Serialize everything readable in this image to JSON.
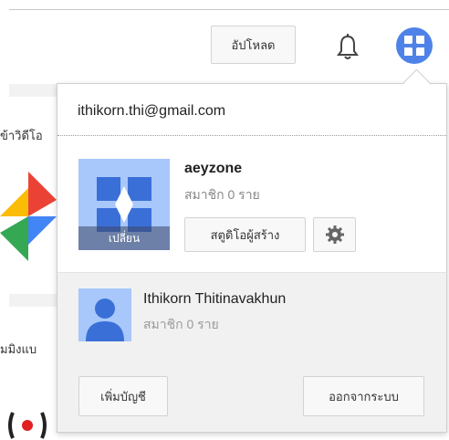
{
  "header": {
    "upload_label": "อัปโหลด",
    "bell_icon": "notifications-bell-icon",
    "avatar_icon": "channel-avatar-icon"
  },
  "background": {
    "snippet1": "ข้าวิดีโอ",
    "snippet2": "มมิงแบ"
  },
  "popup": {
    "email": "ithikorn.thi@gmail.com",
    "channel": {
      "name": "aeyzone",
      "subscribers": "สมาชิก 0 ราย",
      "change_label": "เปลี่ยน",
      "studio_label": "สตูดิโอผู้สร้าง",
      "settings_icon": "gear-icon"
    },
    "other_account": {
      "name": "Ithikorn Thitinavakhun",
      "subscribers": "สมาชิก 0 ราย"
    },
    "footer": {
      "add_account_label": "เพิ่มบัญชี",
      "sign_out_label": "ออกจากระบบ"
    }
  },
  "colors": {
    "avatar_blue": "#4f82e8",
    "thumb_light_blue": "#a8c7fa",
    "accent_blue": "#3a6fd8"
  }
}
